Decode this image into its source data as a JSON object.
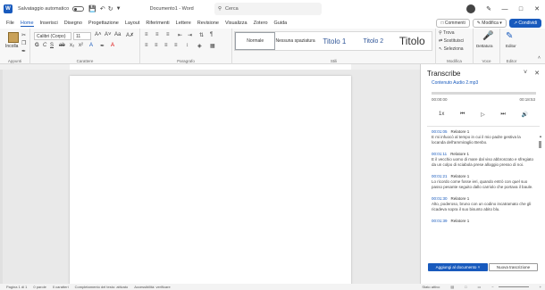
{
  "titlebar": {
    "autosave_label": "Salvataggio automatico",
    "doc_title": "Documento1 - Word",
    "search_placeholder": "Cerca"
  },
  "menubar": {
    "tabs": [
      "File",
      "Home",
      "Inserisci",
      "Disegno",
      "Progettazione",
      "Layout",
      "Riferimenti",
      "Lettere",
      "Revisione",
      "Visualizza",
      "Zotero",
      "Guida"
    ],
    "active_tab": "Home",
    "comments_label": "Commenti",
    "edit_label": "Modifica",
    "share_label": "Condividi"
  },
  "ribbon": {
    "paste_label": "Incolla",
    "clipboard_group": "Appunti",
    "font_name": "Calibri (Corpo)",
    "font_size": "11",
    "font_group": "Carattere",
    "paragraph_group": "Paragrafo",
    "styles": [
      "Normale",
      "Nessuna spaziatura",
      "Titolo 1",
      "Titolo 2",
      "Titolo"
    ],
    "styles_group": "Stili",
    "find_label": "Trova",
    "replace_label": "Sostituisci",
    "select_label": "Seleziona",
    "editing_group": "Modifica",
    "dictate_label": "Dettatura",
    "voice_group": "Voce",
    "editor_label": "Editor",
    "editor_group": "Editor"
  },
  "transcribe": {
    "title": "Transcribe",
    "audio_file": "Contenuto Audio 2.mp3",
    "time_start": "00:00:00",
    "time_end": "00:18:53",
    "speed": "1x",
    "progress": 0,
    "entries": [
      {
        "time": "00:01:05",
        "speaker": "Relatore 1",
        "text": "E mi infuocò al tempo in cui il mio padre gestiva la locanda dell'ammiraglio Benbo."
      },
      {
        "time": "00:01:11",
        "speaker": "Relatore 1",
        "text": "E il vecchio uomo di mare dal viso abbronzato e sfregiato da un colpo di sciabola prese alloggio presso di noi."
      },
      {
        "time": "00:01:21",
        "speaker": "Relatore 1",
        "text": "Lo ricordo come fosse ieri, quando entrò con quel suo passo pesante seguito dallo carriolo che portava il baule."
      },
      {
        "time": "00:01:30",
        "speaker": "Relatore 1",
        "text": "Alto, poderoso, bruno con un codino incatramato che gli ricadeva sopra il suo bisunto abito blu."
      },
      {
        "time": "00:01:39",
        "speaker": "Relatore 1",
        "text": ""
      }
    ],
    "add_button": "Aggiungi al documento",
    "new_button": "Nuova trascrizione"
  },
  "statusbar": {
    "page": "Pagina 1 di 1",
    "words": "0 parole",
    "chars": "0 caratteri",
    "predict": "Completamento del testo: attivato",
    "accessibility": "Accessibilità: verificare",
    "focus": "Stato attivo"
  }
}
